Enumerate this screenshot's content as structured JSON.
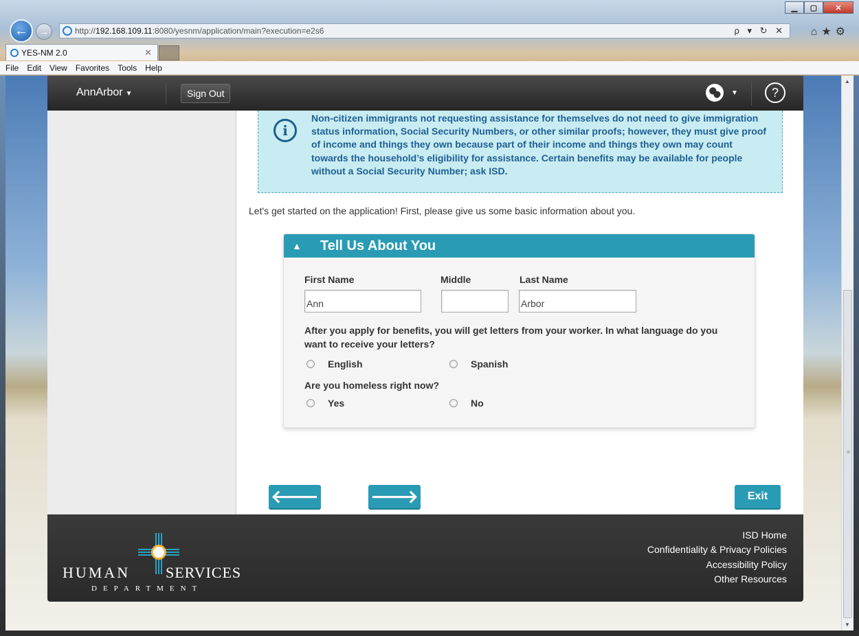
{
  "browser": {
    "url_prefix": "http://",
    "url_host": "192.168.109.11",
    "url_rest": ":8080/yesnm/application/main?execution=e2s6",
    "address_tools": "ρ ▾ ↻ ✕",
    "tab_title": "YES-NM 2.0",
    "menu": [
      "File",
      "Edit",
      "View",
      "Favorites",
      "Tools",
      "Help"
    ]
  },
  "header": {
    "user": "AnnArbor",
    "sign_out": "Sign Out"
  },
  "notice": {
    "text": "Non-citizen immigrants not requesting assistance for themselves do not need to give immigration status information, Social Security Numbers, or other similar proofs; however, they must give proof of income and things they own because part of their income and things they own may count towards the household’s eligibility for assistance. Certain benefits may be available for people without a Social Security Number; ask ISD."
  },
  "intro": "Let's get started on the application! First, please give us some basic information about you.",
  "form": {
    "title": "Tell Us About You",
    "first_name_label": "First Name",
    "first_name_value": "Ann",
    "middle_label": "Middle",
    "middle_value": "",
    "last_name_label": "Last Name",
    "last_name_value": "Arbor",
    "language_question": "After you apply for benefits, you will get letters from your worker. In what language do you want to receive your letters?",
    "language_options": [
      "English",
      "Spanish"
    ],
    "homeless_question": "Are you homeless right now?",
    "homeless_options": [
      "Yes",
      "No"
    ]
  },
  "nav": {
    "exit": "Exit"
  },
  "footer": {
    "logo_human": "HUMAN",
    "logo_services": "SERVICES",
    "logo_dept": "DEPARTMENT",
    "links": [
      "ISD Home",
      "Confidentiality & Privacy Policies",
      "Accessibility Policy",
      "Other Resources"
    ]
  },
  "colors": {
    "accent": "#2a9bb4",
    "notice_bg": "#c8ecf1",
    "notice_text": "#1f5f95"
  }
}
